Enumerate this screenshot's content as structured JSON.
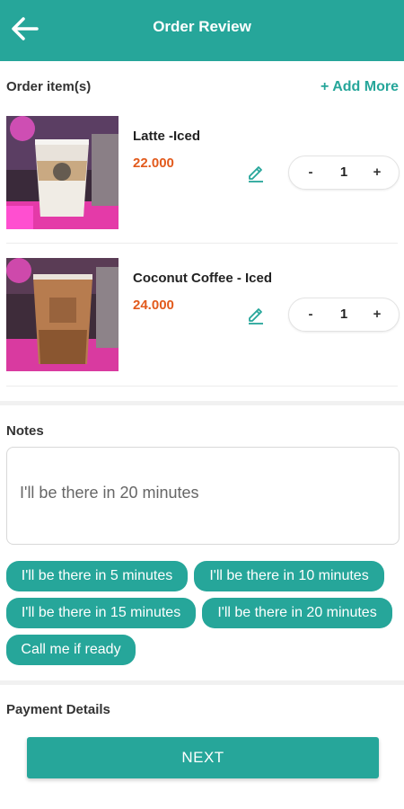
{
  "header": {
    "title": "Order Review",
    "back_icon": "arrow-left-icon"
  },
  "order": {
    "section_label": "Order item(s)",
    "add_more_label": "+ Add More",
    "items": [
      {
        "name": "Latte -Iced",
        "price": "22.000",
        "quantity": "1",
        "minus": "-",
        "plus": "+"
      },
      {
        "name": "Coconut Coffee - Iced",
        "price": "24.000",
        "quantity": "1",
        "minus": "-",
        "plus": "+"
      }
    ]
  },
  "notes": {
    "section_label": "Notes",
    "value": "I'll be there in 20 minutes",
    "quick_replies": [
      "I'll be there in 5 minutes",
      "I'll be there in 10 minutes",
      "I'll be there in 15 minutes",
      "I'll be there in 20 minutes",
      "Call me if ready"
    ]
  },
  "payment": {
    "section_label": "Payment Details"
  },
  "footer": {
    "next_label": "NEXT"
  },
  "colors": {
    "accent": "#26a69a",
    "price": "#e25a1c"
  }
}
